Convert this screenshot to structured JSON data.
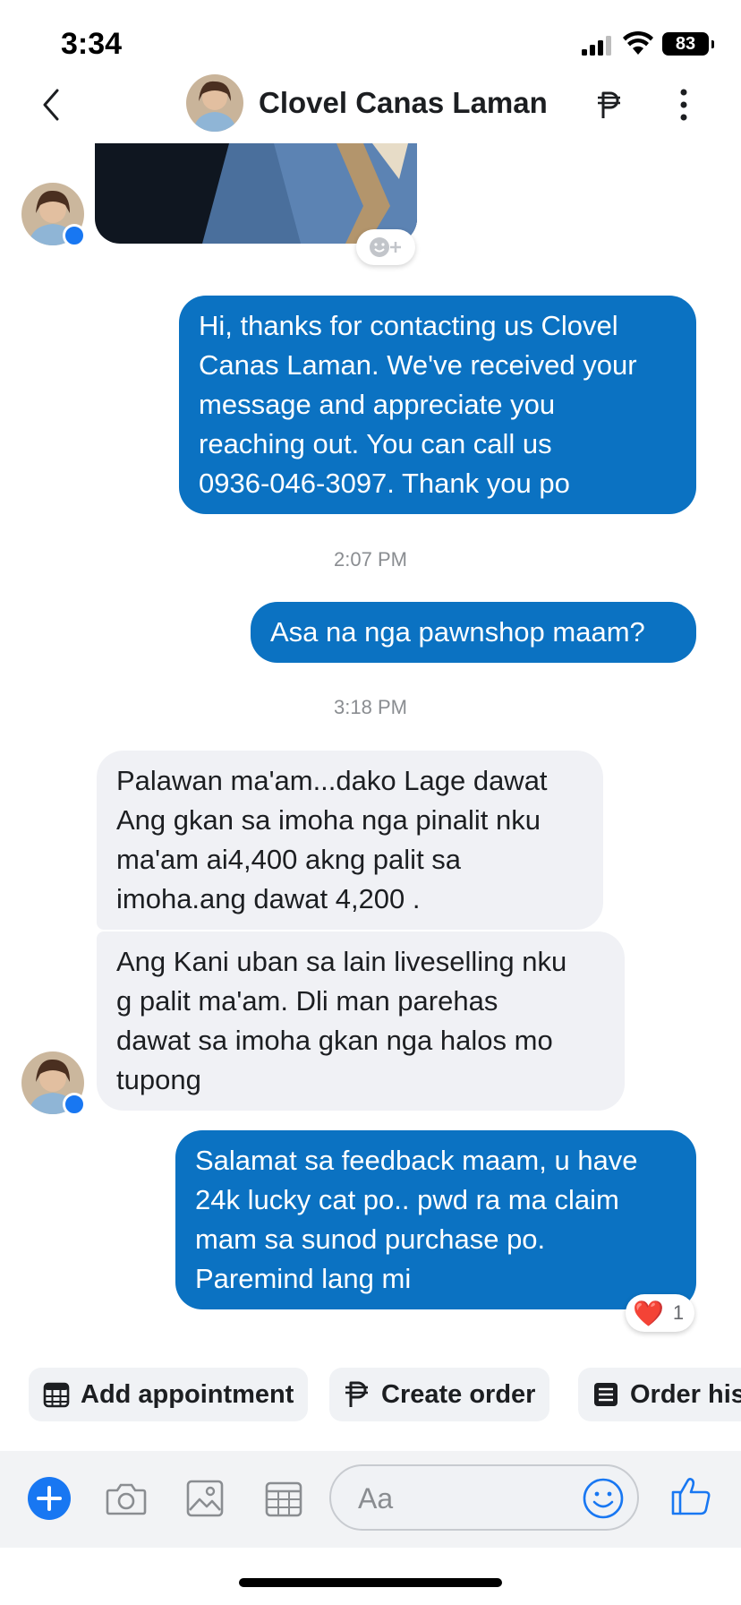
{
  "status_bar": {
    "time": "3:34",
    "battery": "83"
  },
  "header": {
    "contact_name": "Clovel Canas Laman"
  },
  "messages": [
    {
      "type": "outgoing",
      "text": "Hi, thanks for contacting us Clovel\nCanas Laman. We've received your\nmessage and appreciate you\nreaching out. You can call us\n0936-046-3097. Thank you po"
    },
    {
      "type": "timestamp",
      "text": "2:07 PM"
    },
    {
      "type": "outgoing",
      "text": "Asa na nga pawnshop maam?"
    },
    {
      "type": "timestamp",
      "text": "3:18 PM"
    },
    {
      "type": "incoming",
      "text": "Palawan ma'am...dako Lage dawat\nAng gkan sa imoha nga pinalit nku\nma'am ai4,400 akng palit sa\nimoha.ang dawat 4,200 ."
    },
    {
      "type": "incoming",
      "text": "Ang Kani uban sa lain liveselling nku\ng palit ma'am. Dli man parehas\ndawat sa imoha gkan nga halos mo\ntupong"
    },
    {
      "type": "outgoing",
      "text": "Salamat sa feedback maam, u have\n24k lucky cat po.. pwd ra ma claim\nmam sa sunod purchase po.\nParemind lang mi",
      "reaction": {
        "emoji": "❤️",
        "count": "1"
      }
    }
  ],
  "quick_actions": [
    {
      "label": "Add appointment",
      "icon": "calendar-icon"
    },
    {
      "label": "Create order",
      "icon": "peso-icon"
    },
    {
      "label": "Order his",
      "icon": "order-list-icon"
    }
  ],
  "composer": {
    "placeholder": "Aa"
  },
  "colors": {
    "outgoing_bubble": "#0b72c2",
    "incoming_bubble": "#f0f1f5",
    "accent": "#1877f2"
  }
}
